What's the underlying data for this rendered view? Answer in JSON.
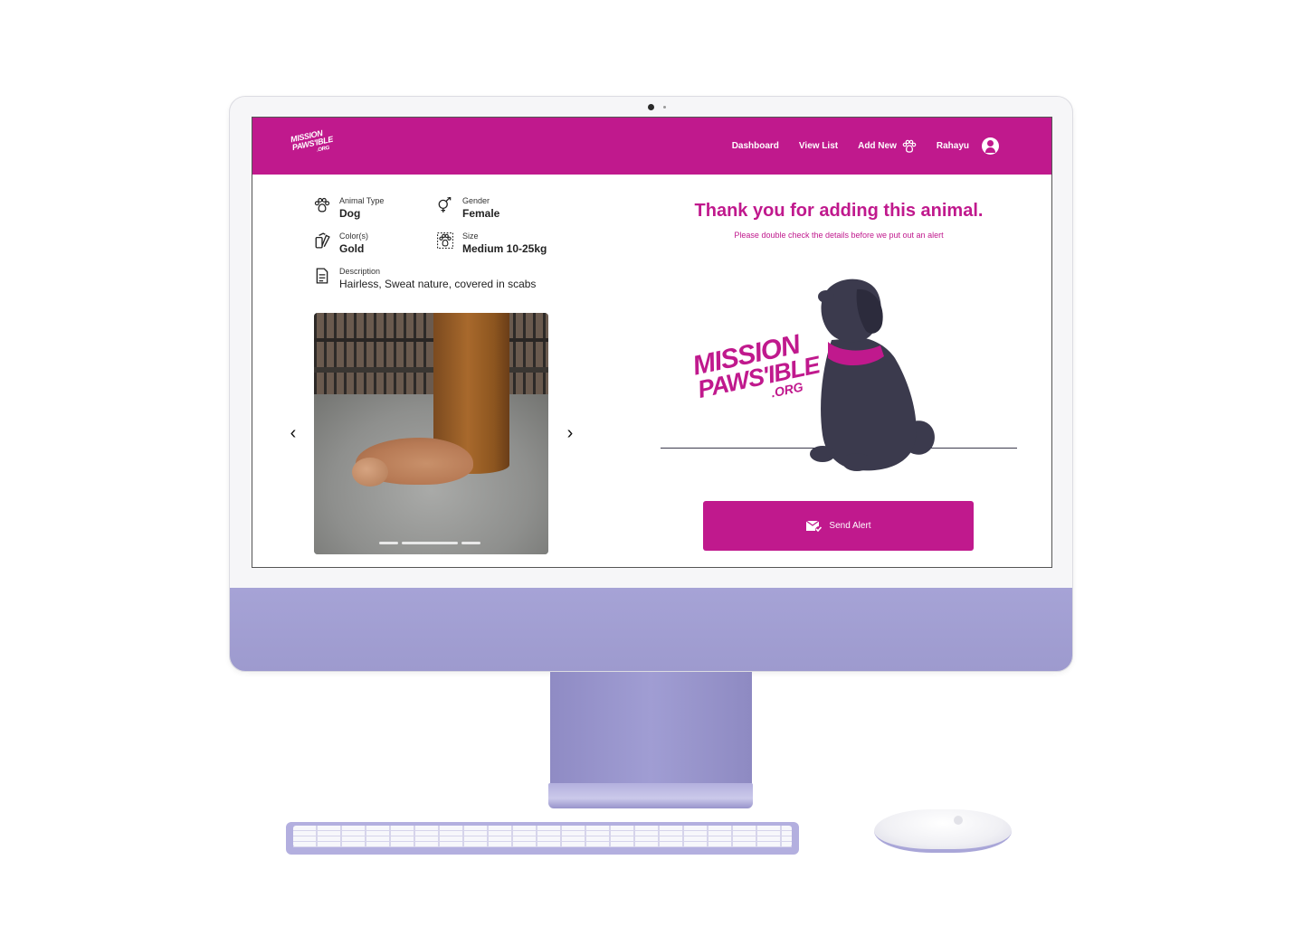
{
  "brand": {
    "logo_line1": "MISSION",
    "logo_line2": "PAWS'IBLE",
    "logo_line3": ".ORG"
  },
  "nav": {
    "dashboard": "Dashboard",
    "view_list": "View List",
    "add_new": "Add New",
    "user_name": "Rahayu"
  },
  "details": {
    "animal_type": {
      "label": "Animal Type",
      "value": "Dog"
    },
    "gender": {
      "label": "Gender",
      "value": "Female"
    },
    "colors": {
      "label": "Color(s)",
      "value": "Gold"
    },
    "size": {
      "label": "Size",
      "value": "Medium 10-25kg"
    },
    "description": {
      "label": "Description",
      "value": "Hairless, Sweat nature, covered in scabs"
    }
  },
  "gallery": {
    "prev_icon": "‹",
    "next_icon": "›"
  },
  "confirmation": {
    "title": "Thank you for adding this animal.",
    "subtitle": "Please double check the details before we put out an alert"
  },
  "actions": {
    "send_alert": "Send Alert"
  },
  "colors": {
    "brand": "#c0198d",
    "dog_silhouette": "#3b3a4d",
    "device": "#a6a3d6"
  }
}
